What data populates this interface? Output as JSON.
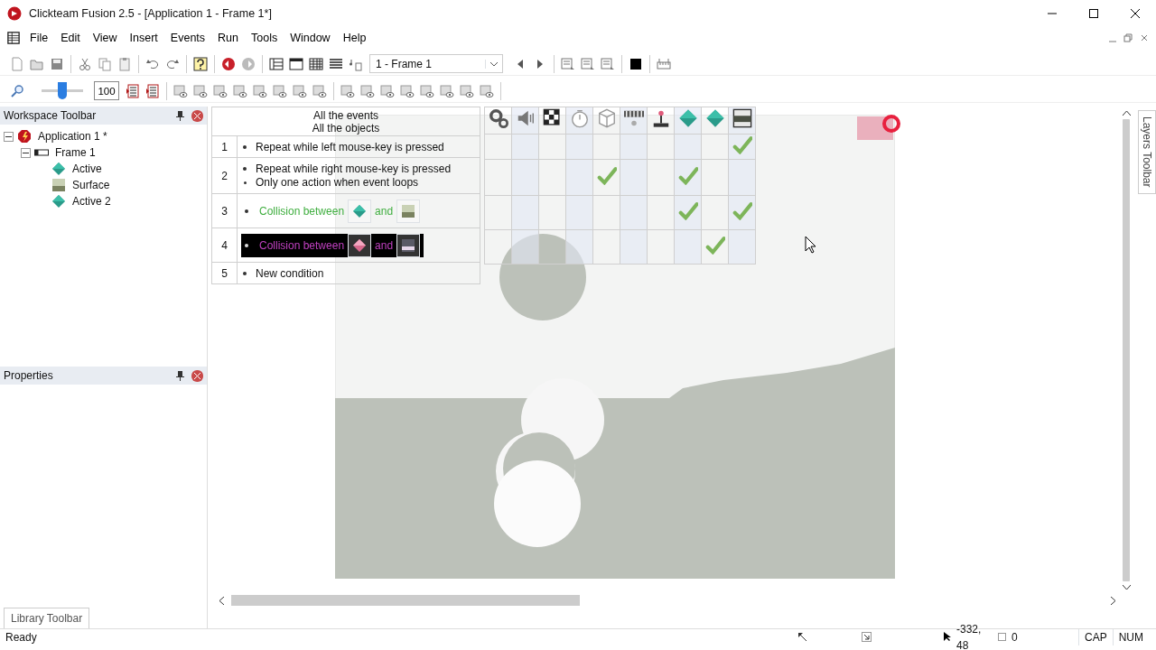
{
  "window": {
    "title": "Clickteam Fusion 2.5 - [Application 1 - Frame 1*]"
  },
  "menu": [
    "File",
    "Edit",
    "View",
    "Insert",
    "Events",
    "Run",
    "Tools",
    "Window",
    "Help"
  ],
  "toolbar": {
    "frame_select": "1 - Frame 1",
    "zoom_value": "100",
    "zoom": {
      "level": 0.5
    }
  },
  "workspace": {
    "title": "Workspace Toolbar",
    "tree": [
      {
        "label": "Application 1 *",
        "kind": "application",
        "expanded": true,
        "children": [
          {
            "label": "Frame 1",
            "kind": "frame",
            "expanded": true,
            "children": [
              {
                "label": "Active",
                "kind": "active"
              },
              {
                "label": "Surface",
                "kind": "surface"
              },
              {
                "label": "Active 2",
                "kind": "active"
              }
            ]
          }
        ]
      }
    ]
  },
  "properties": {
    "title": "Properties"
  },
  "library_tab": "Library Toolbar",
  "layers_tab": "Layers Toolbar",
  "events": {
    "header": [
      "All the events",
      "All the objects"
    ],
    "columns": [
      {
        "kind": "special"
      },
      {
        "kind": "sound"
      },
      {
        "kind": "storyboard"
      },
      {
        "kind": "timer"
      },
      {
        "kind": "create"
      },
      {
        "kind": "keyboard"
      },
      {
        "kind": "player"
      },
      {
        "kind": "active"
      },
      {
        "kind": "active"
      },
      {
        "kind": "surface"
      }
    ],
    "rows": [
      {
        "number": "1",
        "conditions": [
          {
            "kind": "text",
            "text": "Repeat while left mouse-key is pressed",
            "selected": false
          }
        ],
        "checks": [
          false,
          false,
          false,
          false,
          false,
          false,
          false,
          false,
          false,
          true
        ]
      },
      {
        "number": "2",
        "conditions": [
          {
            "kind": "text",
            "text": "Repeat while right mouse-key is pressed",
            "selected": false
          },
          {
            "kind": "option",
            "text": "Only one action when event loops",
            "selected": false
          }
        ],
        "checks": [
          false,
          false,
          false,
          false,
          true,
          false,
          false,
          true,
          false,
          false
        ]
      },
      {
        "number": "3",
        "conditions": [
          {
            "kind": "collision",
            "text": "Collision between",
            "joiner": "and",
            "objects": [
              {
                "kind": "active"
              },
              {
                "kind": "surface"
              }
            ],
            "selected": false
          }
        ],
        "checks": [
          false,
          false,
          false,
          false,
          false,
          false,
          false,
          true,
          false,
          true
        ]
      },
      {
        "number": "4",
        "conditions": [
          {
            "kind": "collision",
            "text": "Collision between",
            "joiner": "and",
            "objects": [
              {
                "kind": "active"
              },
              {
                "kind": "surface"
              }
            ],
            "selected": true
          }
        ],
        "checks": [
          false,
          false,
          false,
          false,
          false,
          false,
          false,
          false,
          true,
          false
        ]
      },
      {
        "number": "5",
        "conditions": [
          {
            "kind": "text",
            "text": "New condition",
            "selected": false
          }
        ]
      }
    ]
  },
  "status_bar": [
    "Ready",
    "-332, 48",
    "0",
    "CAP",
    "NUM"
  ]
}
